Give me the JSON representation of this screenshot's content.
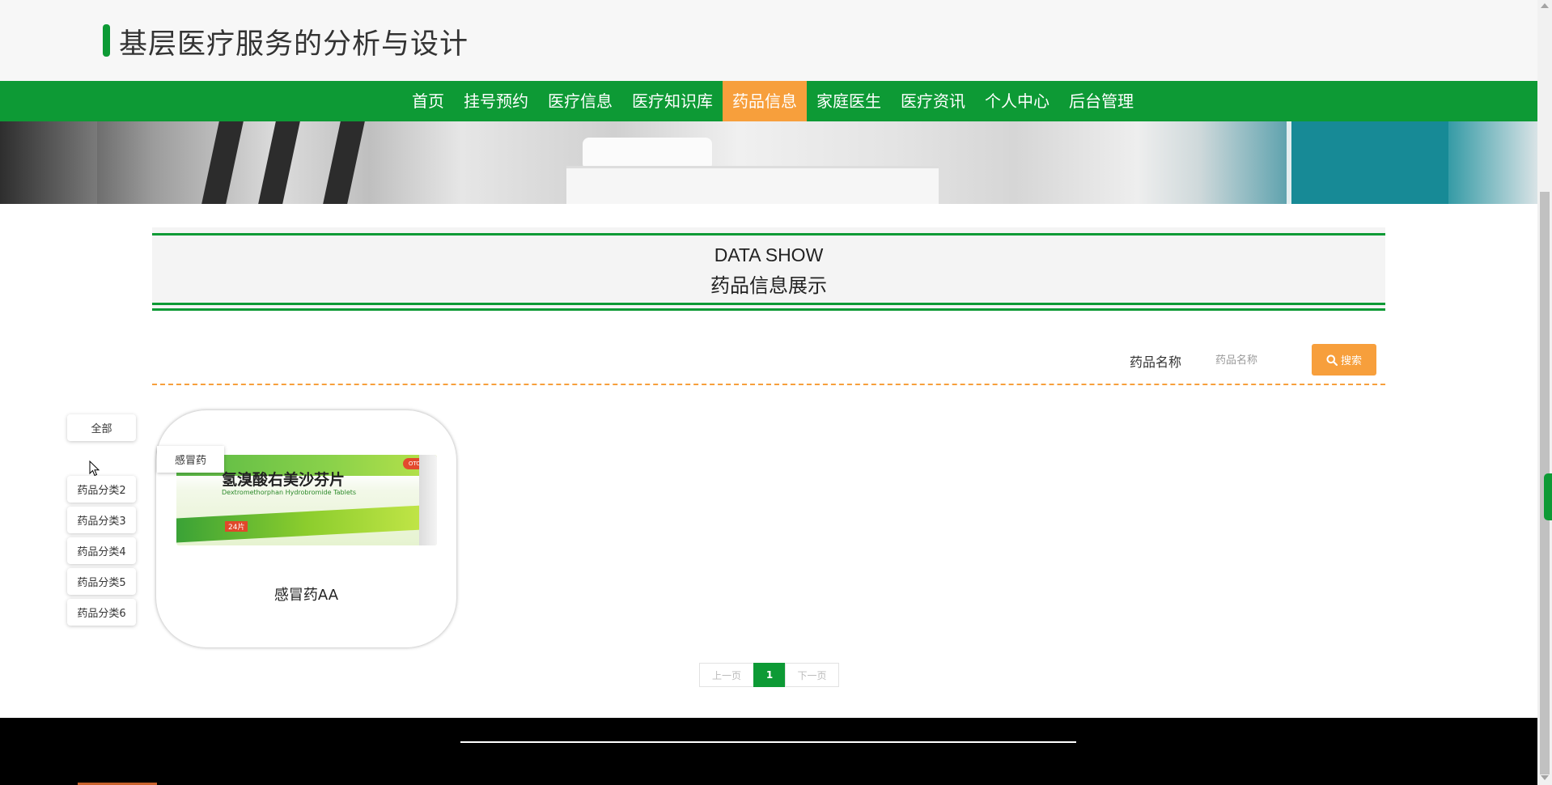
{
  "site": {
    "title": "基层医疗服务的分析与设计"
  },
  "nav": {
    "items": [
      {
        "label": "首页"
      },
      {
        "label": "挂号预约"
      },
      {
        "label": "医疗信息"
      },
      {
        "label": "医疗知识库"
      },
      {
        "label": "药品信息"
      },
      {
        "label": "家庭医生"
      },
      {
        "label": "医疗资讯"
      },
      {
        "label": "个人中心"
      },
      {
        "label": "后台管理"
      }
    ],
    "active": "药品信息"
  },
  "section": {
    "en_title": "DATA SHOW",
    "cn_title": "药品信息展示"
  },
  "search": {
    "label": "药品名称",
    "placeholder": "药品名称",
    "button_label": "搜索"
  },
  "categories": [
    {
      "label": "全部"
    },
    {
      "label": "药品分类2"
    },
    {
      "label": "药品分类3"
    },
    {
      "label": "药品分类4"
    },
    {
      "label": "药品分类5"
    },
    {
      "label": "药品分类6"
    }
  ],
  "products": [
    {
      "tag": "感冒药",
      "name": "感冒药AA",
      "image": {
        "drug_name": "氢溴酸右美沙芬片",
        "drug_en": "Dextromethorphan Hydrobromide Tablets",
        "pill_count": "24片",
        "badge": "OTC"
      }
    }
  ],
  "pagination": {
    "prev_label": "上一页",
    "current_page": "1",
    "next_label": "下一页"
  },
  "colors": {
    "primary": "#0d9a35",
    "accent": "#f79f3c",
    "footer": "#000000"
  }
}
